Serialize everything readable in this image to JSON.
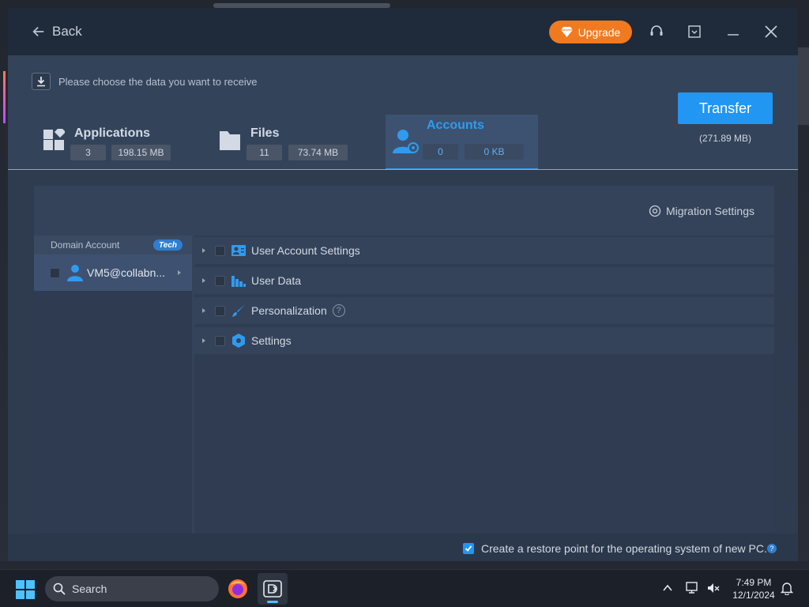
{
  "titlebar": {
    "back_label": "Back",
    "upgrade_label": "Upgrade"
  },
  "header": {
    "hint": "Please choose the data you want to receive",
    "categories": [
      {
        "title": "Applications",
        "count": "3",
        "size": "198.15 MB"
      },
      {
        "title": "Files",
        "count": "11",
        "size": "73.74 MB"
      },
      {
        "title": "Accounts",
        "count": "0",
        "size": "0 KB"
      }
    ],
    "transfer_label": "Transfer",
    "total_size": "(271.89 MB)"
  },
  "content": {
    "migration_settings": "Migration Settings",
    "left": {
      "header": "Domain Account",
      "badge": "Tech",
      "account": "VM5@collabn..."
    },
    "items": [
      {
        "label": "User Account Settings"
      },
      {
        "label": "User Data"
      },
      {
        "label": "Personalization"
      },
      {
        "label": "Settings"
      }
    ]
  },
  "footer": {
    "restore_label": "Create a restore point for the operating system of new PC."
  },
  "taskbar": {
    "search_label": "Search",
    "time": "7:49 PM",
    "date": "12/1/2024"
  },
  "colors": {
    "accent": "#2196f3",
    "upgrade": "#f07a1f",
    "panel": "#34435a"
  }
}
